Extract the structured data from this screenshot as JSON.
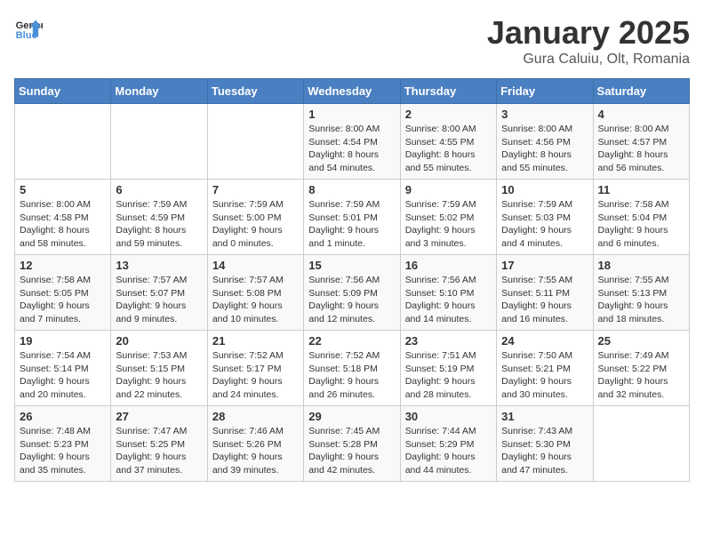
{
  "logo": {
    "line1": "General",
    "line2": "Blue"
  },
  "title": "January 2025",
  "subtitle": "Gura Caluiu, Olt, Romania",
  "days_header": [
    "Sunday",
    "Monday",
    "Tuesday",
    "Wednesday",
    "Thursday",
    "Friday",
    "Saturday"
  ],
  "weeks": [
    [
      {
        "day": "",
        "info": ""
      },
      {
        "day": "",
        "info": ""
      },
      {
        "day": "",
        "info": ""
      },
      {
        "day": "1",
        "info": "Sunrise: 8:00 AM\nSunset: 4:54 PM\nDaylight: 8 hours\nand 54 minutes."
      },
      {
        "day": "2",
        "info": "Sunrise: 8:00 AM\nSunset: 4:55 PM\nDaylight: 8 hours\nand 55 minutes."
      },
      {
        "day": "3",
        "info": "Sunrise: 8:00 AM\nSunset: 4:56 PM\nDaylight: 8 hours\nand 55 minutes."
      },
      {
        "day": "4",
        "info": "Sunrise: 8:00 AM\nSunset: 4:57 PM\nDaylight: 8 hours\nand 56 minutes."
      }
    ],
    [
      {
        "day": "5",
        "info": "Sunrise: 8:00 AM\nSunset: 4:58 PM\nDaylight: 8 hours\nand 58 minutes."
      },
      {
        "day": "6",
        "info": "Sunrise: 7:59 AM\nSunset: 4:59 PM\nDaylight: 8 hours\nand 59 minutes."
      },
      {
        "day": "7",
        "info": "Sunrise: 7:59 AM\nSunset: 5:00 PM\nDaylight: 9 hours\nand 0 minutes."
      },
      {
        "day": "8",
        "info": "Sunrise: 7:59 AM\nSunset: 5:01 PM\nDaylight: 9 hours\nand 1 minute."
      },
      {
        "day": "9",
        "info": "Sunrise: 7:59 AM\nSunset: 5:02 PM\nDaylight: 9 hours\nand 3 minutes."
      },
      {
        "day": "10",
        "info": "Sunrise: 7:59 AM\nSunset: 5:03 PM\nDaylight: 9 hours\nand 4 minutes."
      },
      {
        "day": "11",
        "info": "Sunrise: 7:58 AM\nSunset: 5:04 PM\nDaylight: 9 hours\nand 6 minutes."
      }
    ],
    [
      {
        "day": "12",
        "info": "Sunrise: 7:58 AM\nSunset: 5:05 PM\nDaylight: 9 hours\nand 7 minutes."
      },
      {
        "day": "13",
        "info": "Sunrise: 7:57 AM\nSunset: 5:07 PM\nDaylight: 9 hours\nand 9 minutes."
      },
      {
        "day": "14",
        "info": "Sunrise: 7:57 AM\nSunset: 5:08 PM\nDaylight: 9 hours\nand 10 minutes."
      },
      {
        "day": "15",
        "info": "Sunrise: 7:56 AM\nSunset: 5:09 PM\nDaylight: 9 hours\nand 12 minutes."
      },
      {
        "day": "16",
        "info": "Sunrise: 7:56 AM\nSunset: 5:10 PM\nDaylight: 9 hours\nand 14 minutes."
      },
      {
        "day": "17",
        "info": "Sunrise: 7:55 AM\nSunset: 5:11 PM\nDaylight: 9 hours\nand 16 minutes."
      },
      {
        "day": "18",
        "info": "Sunrise: 7:55 AM\nSunset: 5:13 PM\nDaylight: 9 hours\nand 18 minutes."
      }
    ],
    [
      {
        "day": "19",
        "info": "Sunrise: 7:54 AM\nSunset: 5:14 PM\nDaylight: 9 hours\nand 20 minutes."
      },
      {
        "day": "20",
        "info": "Sunrise: 7:53 AM\nSunset: 5:15 PM\nDaylight: 9 hours\nand 22 minutes."
      },
      {
        "day": "21",
        "info": "Sunrise: 7:52 AM\nSunset: 5:17 PM\nDaylight: 9 hours\nand 24 minutes."
      },
      {
        "day": "22",
        "info": "Sunrise: 7:52 AM\nSunset: 5:18 PM\nDaylight: 9 hours\nand 26 minutes."
      },
      {
        "day": "23",
        "info": "Sunrise: 7:51 AM\nSunset: 5:19 PM\nDaylight: 9 hours\nand 28 minutes."
      },
      {
        "day": "24",
        "info": "Sunrise: 7:50 AM\nSunset: 5:21 PM\nDaylight: 9 hours\nand 30 minutes."
      },
      {
        "day": "25",
        "info": "Sunrise: 7:49 AM\nSunset: 5:22 PM\nDaylight: 9 hours\nand 32 minutes."
      }
    ],
    [
      {
        "day": "26",
        "info": "Sunrise: 7:48 AM\nSunset: 5:23 PM\nDaylight: 9 hours\nand 35 minutes."
      },
      {
        "day": "27",
        "info": "Sunrise: 7:47 AM\nSunset: 5:25 PM\nDaylight: 9 hours\nand 37 minutes."
      },
      {
        "day": "28",
        "info": "Sunrise: 7:46 AM\nSunset: 5:26 PM\nDaylight: 9 hours\nand 39 minutes."
      },
      {
        "day": "29",
        "info": "Sunrise: 7:45 AM\nSunset: 5:28 PM\nDaylight: 9 hours\nand 42 minutes."
      },
      {
        "day": "30",
        "info": "Sunrise: 7:44 AM\nSunset: 5:29 PM\nDaylight: 9 hours\nand 44 minutes."
      },
      {
        "day": "31",
        "info": "Sunrise: 7:43 AM\nSunset: 5:30 PM\nDaylight: 9 hours\nand 47 minutes."
      },
      {
        "day": "",
        "info": ""
      }
    ]
  ]
}
